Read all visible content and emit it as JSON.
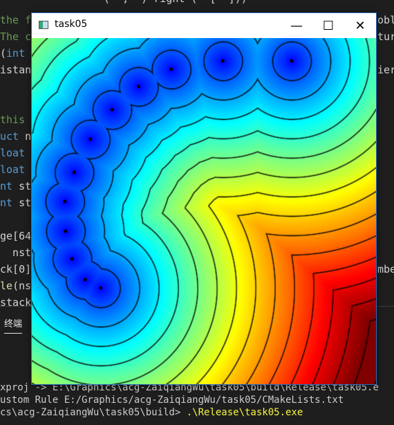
{
  "editor": {
    "lines": [
      {
        "segments": [
          {
            "t": "the f",
            "c": "cm"
          }
        ]
      },
      {
        "segments": [
          {
            "t": "The c",
            "c": "cm"
          }
        ]
      },
      {
        "segments": [
          {
            "t": "(",
            "c": "tx"
          },
          {
            "t": "int",
            "c": "kw"
          }
        ]
      },
      {
        "segments": [
          {
            "t": "istan",
            "c": "tx"
          }
        ]
      },
      {
        "segments": [
          {
            "t": "this",
            "c": "cm"
          }
        ]
      },
      {
        "segments": [
          {
            "t": "uct ",
            "c": "kw"
          },
          {
            "t": "n",
            "c": "tx"
          }
        ]
      },
      {
        "segments": [
          {
            "t": "loat",
            "c": "kw"
          }
        ]
      },
      {
        "segments": [
          {
            "t": "loat",
            "c": "kw"
          }
        ]
      },
      {
        "segments": [
          {
            "t": "nt ",
            "c": "kw"
          },
          {
            "t": "st",
            "c": "tx"
          }
        ]
      },
      {
        "segments": [
          {
            "t": "nt ",
            "c": "kw"
          },
          {
            "t": "st",
            "c": "tx"
          }
        ]
      },
      {
        "segments": [
          {
            "t": "ge[64",
            "c": "tx"
          }
        ]
      },
      {
        "segments": [
          {
            "t": "  nsta",
            "c": "tx"
          }
        ]
      },
      {
        "segments": [
          {
            "t": "ck[0]",
            "c": "tx"
          }
        ]
      },
      {
        "segments": [
          {
            "t": "le",
            "c": "fn"
          },
          {
            "t": "(ns",
            "c": "tx"
          }
        ]
      },
      {
        "segments": [
          {
            "t": "stack",
            "c": "tx"
          }
        ]
      }
    ],
    "right_fragments": [
      {
        "text": "obl",
        "c": "tx"
      },
      {
        "text": "tur",
        "c": "tx"
      },
      {
        "text": "ier",
        "c": "tx"
      },
      {
        "text": "mbe",
        "c": "tx"
      }
    ],
    "top_fragment": "(  ,  ) right (  [  ]))"
  },
  "panel": {
    "tab_label": "终端",
    "lines": [
      {
        "text": "xproj -> E:\\Graphics\\acg-ZaiqiangWu\\task05\\build\\Release\\task05.e"
      },
      {
        "text": "ustom Rule E:/Graphics/acg-ZaiqiangWu/task05/CMakeLists.txt"
      },
      {
        "text": "cs\\acg-ZaiqiangWu\\task05\\build> ",
        "cmd": ".\\Release\\task05.exe"
      }
    ]
  },
  "window": {
    "title": "task05",
    "minimize_glyph": "—",
    "maximize_glyph": "☐",
    "close_glyph": "✕",
    "points": [
      {
        "x": 0.2,
        "y": 0.722
      },
      {
        "x": 0.155,
        "y": 0.698
      },
      {
        "x": 0.117,
        "y": 0.638
      },
      {
        "x": 0.098,
        "y": 0.558
      },
      {
        "x": 0.096,
        "y": 0.472
      },
      {
        "x": 0.123,
        "y": 0.388
      },
      {
        "x": 0.17,
        "y": 0.292
      },
      {
        "x": 0.233,
        "y": 0.207
      },
      {
        "x": 0.31,
        "y": 0.14
      },
      {
        "x": 0.405,
        "y": 0.09
      },
      {
        "x": 0.555,
        "y": 0.066
      },
      {
        "x": 0.755,
        "y": 0.066
      }
    ]
  }
}
